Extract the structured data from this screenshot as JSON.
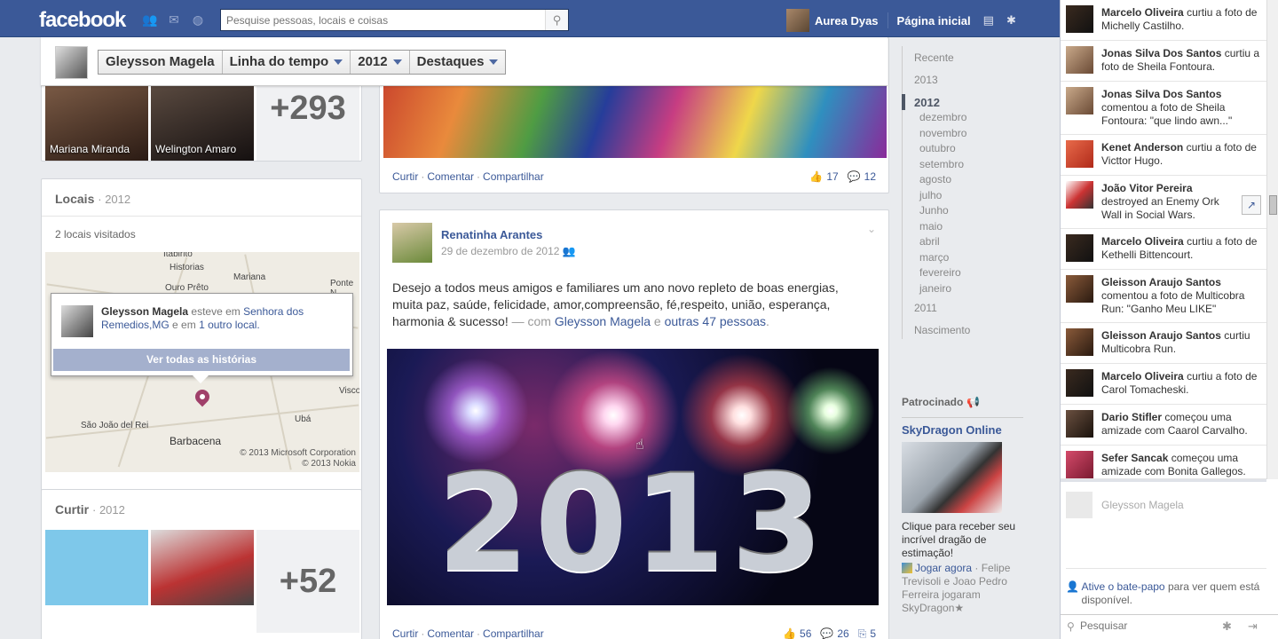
{
  "topbar": {
    "logo": "facebook",
    "search_placeholder": "Pesquise pessoas, locais e coisas",
    "user_name": "Aurea Dyas",
    "home_link": "Página inicial"
  },
  "timeline_nav": {
    "profile_name": "Gleysson Magela",
    "timeline_label": "Linha do tempo",
    "year_label": "2012",
    "highlights_label": "Destaques"
  },
  "friends_card": {
    "friend1": "Mariana Miranda",
    "friend2": "Welington Amaro",
    "more_count": "+293"
  },
  "locais_card": {
    "title": "Locais",
    "year": "· 2012",
    "visited": "2 locais visitados",
    "towns": [
      "Itabirito",
      "Historias",
      "Mariana",
      "Ouro Prêto",
      "Ponte N",
      "Visco",
      "Ubá",
      "São João del Rei",
      "Barbacena"
    ],
    "copyright1": "© 2013 Microsoft Corporation",
    "copyright2": "© 2013 Nokia",
    "popover": {
      "name": "Gleysson Magela",
      "was_at": "esteve em",
      "place": "Senhora dos Remedios,MG",
      "and_in": "e em",
      "other": "1 outro local.",
      "button": "Ver todas as histórias"
    }
  },
  "curtir_card": {
    "title": "Curtir",
    "year": "· 2012",
    "more_count": "+52"
  },
  "post1": {
    "actions": {
      "like": "Curtir",
      "comment": "Comentar",
      "share": "Compartilhar"
    },
    "likes": "17",
    "comments": "12"
  },
  "post2": {
    "author": "Renatinha Arantes",
    "date": "29 de dezembro de 2012",
    "text": "Desejo a todos meus amigos e familiares um ano novo repleto de boas energias, muita paz, saúde, felicidade, amor,compreensão, fé,respeito, união, esperança, harmonia & sucesso!",
    "with_prefix": "— com",
    "tag1": "Gleysson Magela",
    "and": "e",
    "tag2": "outras 47 pessoas",
    "image_text": "2013",
    "actions": {
      "like": "Curtir",
      "comment": "Comentar",
      "share": "Compartilhar"
    },
    "likes": "56",
    "comments": "26",
    "shares": "5"
  },
  "years_nav": {
    "recent": "Recente",
    "y2013": "2013",
    "y2012": "2012",
    "months": [
      "dezembro",
      "novembro",
      "outubro",
      "setembro",
      "agosto",
      "julho",
      "Junho",
      "maio",
      "abril",
      "março",
      "fevereiro",
      "janeiro"
    ],
    "y2011": "2011",
    "birth": "Nascimento"
  },
  "sponsored": {
    "title": "Patrocinado",
    "name": "SkyDragon Online",
    "desc": "Clique para receber seu incrível dragão de estimação!",
    "play": "Jogar agora",
    "play_rest": "· Felipe Trevisoli e Joao Pedro Ferreira jogaram SkyDragon★"
  },
  "ticker": [
    {
      "name": "Marcelo Oliveira",
      "text": "curtiu a foto de Michelly Castilho."
    },
    {
      "name": "Jonas Silva Dos Santos",
      "text": "curtiu a foto de Sheila Fontoura."
    },
    {
      "name": "Jonas Silva Dos Santos",
      "text": "comentou a foto de Sheila Fontoura: \"que lindo awn...\""
    },
    {
      "name": "Kenet Anderson",
      "text": "curtiu a foto de Victtor Hugo."
    },
    {
      "name": "João Vitor Pereira",
      "text": "destroyed an Enemy Ork Wall in Social Wars."
    },
    {
      "name": "Marcelo Oliveira",
      "text": "curtiu a foto de Kethelli Bittencourt."
    },
    {
      "name": "Gleisson Araujo Santos",
      "text": "comentou a foto de Multicobra Run: \"Ganho Meu LIKE\""
    },
    {
      "name": "Gleisson Araujo Santos",
      "text": "curtiu Multicobra Run."
    },
    {
      "name": "Marcelo Oliveira",
      "text": "curtiu a foto de Carol Tomacheski."
    },
    {
      "name": "Dario Stifler",
      "text": "começou uma amizade com Caarol Carvalho."
    },
    {
      "name": "Sefer Sancak",
      "text": "começou uma amizade com Bonita Gallegos."
    }
  ],
  "chat": {
    "friend": "Gleysson Magela",
    "activate": "Ative o bate-papo",
    "activate_rest": "para ver quem está disponível.",
    "search_placeholder": "Pesquisar"
  }
}
